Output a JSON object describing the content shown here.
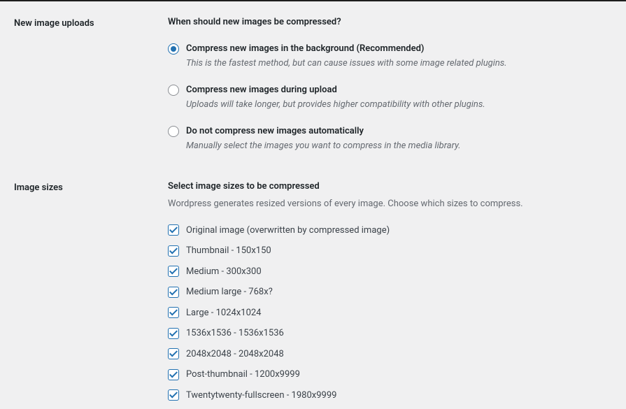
{
  "uploads": {
    "section_label": "New image uploads",
    "title": "When should new images be compressed?",
    "options": [
      {
        "label": "Compress new images in the background (Recommended)",
        "description": "This is the fastest method, but can cause issues with some image related plugins.",
        "checked": true
      },
      {
        "label": "Compress new images during upload",
        "description": "Uploads will take longer, but provides higher compatibility with other plugins.",
        "checked": false
      },
      {
        "label": "Do not compress new images automatically",
        "description": "Manually select the images you want to compress in the media library.",
        "checked": false
      }
    ]
  },
  "sizes": {
    "section_label": "Image sizes",
    "title": "Select image sizes to be compressed",
    "description": "Wordpress generates resized versions of every image. Choose which sizes to compress.",
    "items": [
      {
        "label": "Original image (overwritten by compressed image)",
        "checked": true
      },
      {
        "label": "Thumbnail - 150x150",
        "checked": true
      },
      {
        "label": "Medium - 300x300",
        "checked": true
      },
      {
        "label": "Medium large - 768x?",
        "checked": true
      },
      {
        "label": "Large - 1024x1024",
        "checked": true
      },
      {
        "label": "1536x1536 - 1536x1536",
        "checked": true
      },
      {
        "label": "2048x2048 - 2048x2048",
        "checked": true
      },
      {
        "label": "Post-thumbnail - 1200x9999",
        "checked": true
      },
      {
        "label": "Twentytwenty-fullscreen - 1980x9999",
        "checked": true
      }
    ]
  }
}
